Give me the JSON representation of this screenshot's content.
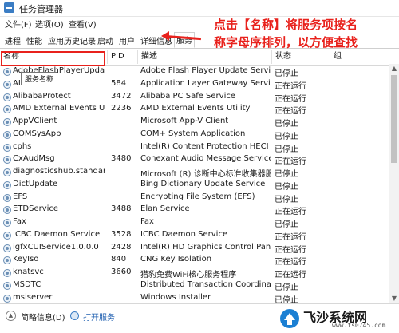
{
  "window": {
    "title": "任务管理器"
  },
  "menu": [
    "文件(F)",
    "选项(O)",
    "查看(V)"
  ],
  "tabs": [
    "进程",
    "性能",
    "应用历史记录",
    "启动",
    "用户",
    "详细信息",
    "服务"
  ],
  "active_tab": "服务",
  "columns": {
    "name": "名称",
    "pid": "PID",
    "desc": "描述",
    "status": "状态",
    "group": "组"
  },
  "tooltip": "服务名称",
  "rows": [
    {
      "name": "AdobeFlashPlayerUpdat...",
      "pid": "",
      "desc": "Adobe Flash Player Update Service",
      "status": "已停止"
    },
    {
      "name": "ALG",
      "pid": "584",
      "desc": "Application Layer Gateway Service",
      "status": "正在运行"
    },
    {
      "name": "AlibabaProtect",
      "pid": "3472",
      "desc": "Alibaba PC Safe Service",
      "status": "正在运行"
    },
    {
      "name": "AMD External Events Utili...",
      "pid": "2236",
      "desc": "AMD External Events Utility",
      "status": "正在运行"
    },
    {
      "name": "AppVClient",
      "pid": "",
      "desc": "Microsoft App-V Client",
      "status": "已停止"
    },
    {
      "name": "COMSysApp",
      "pid": "",
      "desc": "COM+ System Application",
      "status": "已停止"
    },
    {
      "name": "cphs",
      "pid": "",
      "desc": "Intel(R) Content Protection HECI S...",
      "status": "已停止"
    },
    {
      "name": "CxAudMsg",
      "pid": "3480",
      "desc": "Conexant Audio Message Service",
      "status": "正在运行"
    },
    {
      "name": "diagnosticshub.standard...",
      "pid": "",
      "desc": "Microsoft (R) 诊断中心标准收集器服...",
      "status": "已停止"
    },
    {
      "name": "DictUpdate",
      "pid": "",
      "desc": "Bing Dictionary Update Service",
      "status": "已停止"
    },
    {
      "name": "EFS",
      "pid": "",
      "desc": "Encrypting File System (EFS)",
      "status": "已停止"
    },
    {
      "name": "ETDService",
      "pid": "3488",
      "desc": "Elan Service",
      "status": "正在运行"
    },
    {
      "name": "Fax",
      "pid": "",
      "desc": "Fax",
      "status": "已停止"
    },
    {
      "name": "ICBC Daemon Service",
      "pid": "3528",
      "desc": "ICBC Daemon Service",
      "status": "正在运行"
    },
    {
      "name": "igfxCUIService1.0.0.0",
      "pid": "2428",
      "desc": "Intel(R) HD Graphics Control Panel...",
      "status": "正在运行"
    },
    {
      "name": "KeyIso",
      "pid": "840",
      "desc": "CNG Key Isolation",
      "status": "正在运行"
    },
    {
      "name": "knatsvc",
      "pid": "3660",
      "desc": "猎豹免费WiFi核心服务程序",
      "status": "正在运行"
    },
    {
      "name": "MSDTC",
      "pid": "",
      "desc": "Distributed Transaction Coordinator",
      "status": "已停止"
    },
    {
      "name": "msiserver",
      "pid": "",
      "desc": "Windows Installer",
      "status": "已停止"
    }
  ],
  "footer": {
    "less": "简略信息(D)",
    "open": "打开服务"
  },
  "annotation": {
    "line1": "点击【名称】将服务项按名",
    "line2": "称字母序排列，以方便查找"
  },
  "watermark": {
    "brand": "飞沙系统网",
    "url": "www.fs0745.com"
  },
  "colors": {
    "annotation": "#e8211c",
    "icon": "#3b7dc4"
  }
}
